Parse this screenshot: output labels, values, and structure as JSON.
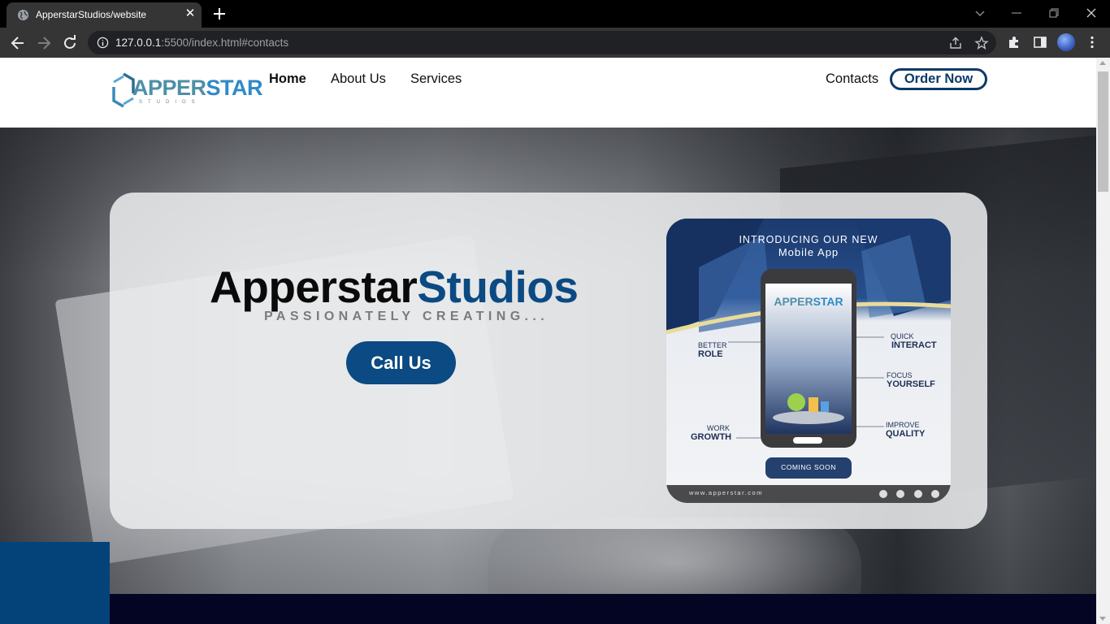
{
  "browser": {
    "tab_title": "ApperstarStudios/website",
    "url_host": "127.0.0.1",
    "url_rest": ":5500/index.html#contacts"
  },
  "site": {
    "logo": {
      "main_a": "APPER",
      "main_b": "STAR",
      "sub": "STUDIOS"
    },
    "nav": {
      "home": "Home",
      "about": "About Us",
      "services": "Services",
      "contacts": "Contacts",
      "order": "Order Now"
    },
    "hero": {
      "title_part1": "Apperstar",
      "title_part2": "Studios",
      "tagline": "PASSIONATELY CREATING...",
      "call_button": "Call Us"
    },
    "promo": {
      "heading": "INTRODUCING OUR NEW",
      "subheading": "Mobile App",
      "phone_logo_a": "APPER",
      "phone_logo_b": "STAR",
      "feature_left_1_small": "BETTER",
      "feature_left_1_big": "ROLE",
      "feature_left_2_small": "WORK",
      "feature_left_2_big": "GROWTH",
      "feature_right_1_small": "QUICK",
      "feature_right_1_big": "INTERACT",
      "feature_right_2_small": "FOCUS",
      "feature_right_2_big": "YOURSELF",
      "feature_right_3_small": "IMPROVE",
      "feature_right_3_big": "QUALITY",
      "coming_soon": "COMING SOON",
      "website": "www.apperstar.com"
    }
  },
  "colors": {
    "brand_blue": "#0b4a82",
    "navy": "#0b3a66",
    "dark_strip": "#030522",
    "chrome_dark": "#353535"
  }
}
